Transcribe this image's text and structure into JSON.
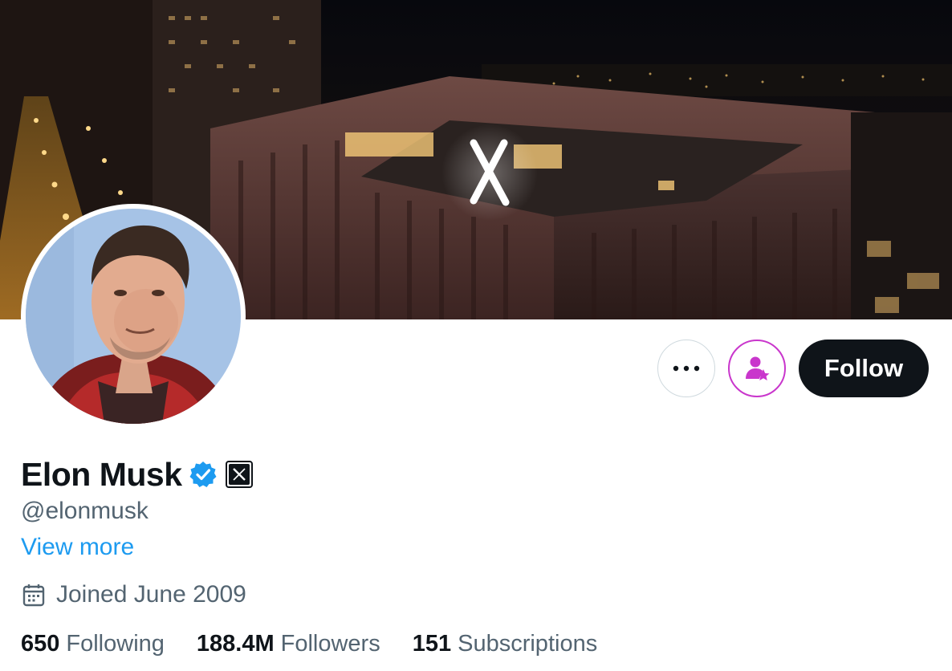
{
  "profile": {
    "display_name": "Elon Musk",
    "handle": "@elonmusk",
    "view_more": "View more",
    "joined": "Joined June 2009"
  },
  "actions": {
    "follow_label": "Follow"
  },
  "stats": [
    {
      "value": "650",
      "label": "Following"
    },
    {
      "value": "188.4M",
      "label": "Followers"
    },
    {
      "value": "151",
      "label": "Subscriptions"
    }
  ],
  "banner": {
    "sign": "X"
  },
  "colors": {
    "accent": "#1d9bf0",
    "subscribe": "#c936cc",
    "follow_bg": "#0f1419",
    "secondary_text": "#536471"
  },
  "icons": {
    "more": "more-horizontal-icon",
    "subscribe": "person-star-icon",
    "verified": "verified-badge-icon",
    "affiliation": "x-logo-icon",
    "calendar": "calendar-icon"
  }
}
